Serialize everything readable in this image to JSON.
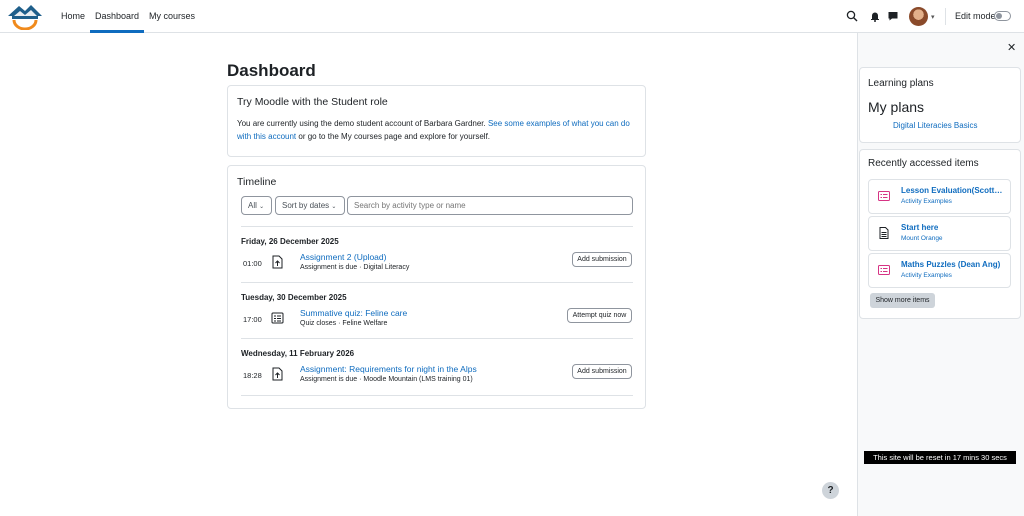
{
  "app": {
    "logo_name": "mount-orange-logo",
    "logo_text": "MOUNT ORANGE",
    "accent_color": "#0f6cbf"
  },
  "nav": {
    "items": [
      {
        "label": "Home"
      },
      {
        "label": "Dashboard",
        "active": true
      },
      {
        "label": "My courses"
      }
    ],
    "edit_mode_label": "Edit mode",
    "icons": [
      "search-icon",
      "bell-icon",
      "chat-icon",
      "avatar",
      "chevron-down-icon"
    ]
  },
  "main": {
    "title": "Dashboard",
    "intro_card": {
      "heading": "Try Moodle with the Student role",
      "text_before": "You are currently using the demo student account of Barbara Gardner. ",
      "link_text": "See some examples of what you can do with this account",
      "text_after": " or go to the My courses page and explore for yourself."
    },
    "timeline": {
      "heading": "Timeline",
      "filter_label": "All",
      "sort_label": "Sort by dates",
      "search_placeholder": "Search by activity type or name",
      "groups": [
        {
          "date": "Friday, 26 December 2025",
          "time": "01:00",
          "icon": "upload-icon",
          "title": "Assignment 2 (Upload)",
          "subtitle": "Assignment is due · Digital Literacy",
          "action": "Add submission"
        },
        {
          "date": "Tuesday, 30 December 2025",
          "time": "17:00",
          "icon": "quiz-icon",
          "title": "Summative quiz: Feline care",
          "subtitle": "Quiz closes · Feline Welfare",
          "action": "Attempt quiz now"
        },
        {
          "date": "Wednesday, 11 February 2026",
          "time": "18:28",
          "icon": "upload-icon",
          "title": "Assignment: Requirements for night in the Alps",
          "subtitle": "Assignment is due · Moodle Mountain (LMS training 01)",
          "action": "Add submission"
        }
      ]
    }
  },
  "drawer": {
    "learning_plans": {
      "heading": "Learning plans",
      "subheading": "My plans",
      "plan_link": "Digital Literacies Basics"
    },
    "recent": {
      "heading": "Recently accessed items",
      "items": [
        {
          "title": "Lesson Evaluation(Scott ...",
          "subtitle": "Activity Examples",
          "icon": "feedback-icon"
        },
        {
          "title": "Start here",
          "subtitle": "Mount Orange",
          "icon": "page-icon"
        },
        {
          "title": "Maths Puzzles (Dean Ang)",
          "subtitle": "Activity Examples",
          "icon": "feedback-icon"
        }
      ],
      "show_more": "Show more items"
    },
    "reset_message": "This site will be reset in 17 mins 30 secs"
  },
  "help_label": "?"
}
